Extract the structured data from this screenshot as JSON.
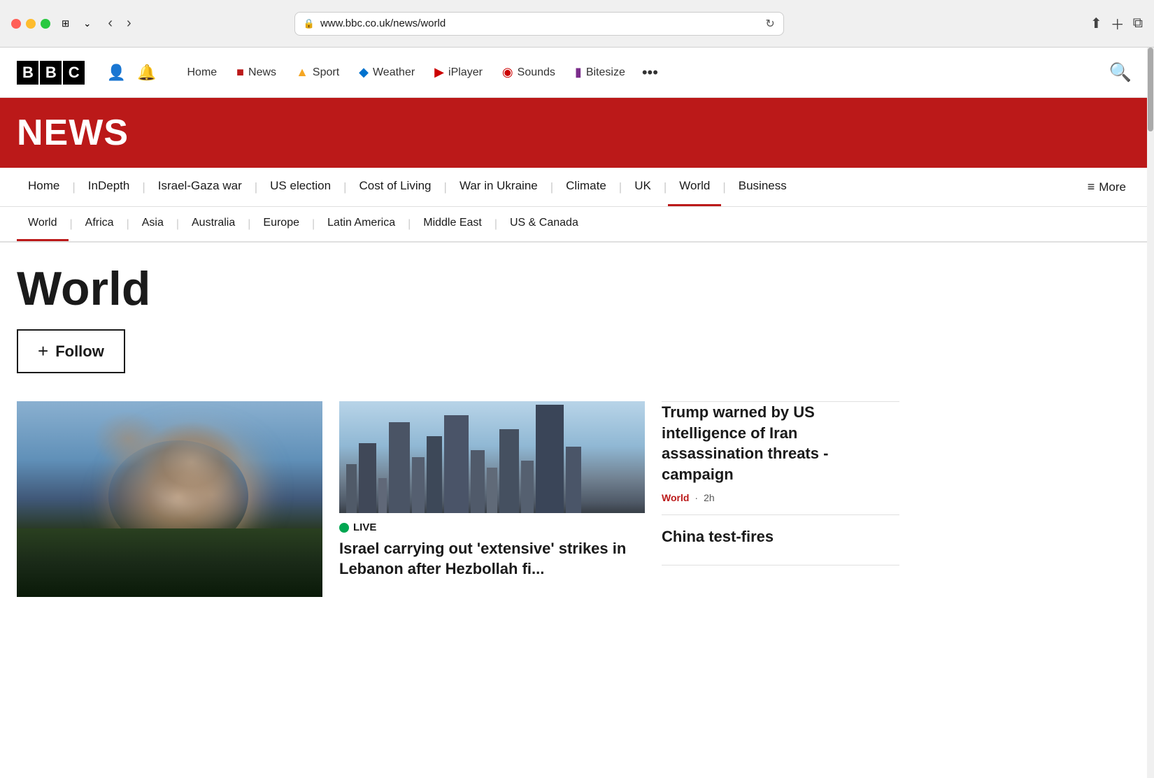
{
  "browser": {
    "url": "www.bbc.co.uk/news/world",
    "lock_icon": "🔒"
  },
  "bbc_header": {
    "logo_letters": [
      "B",
      "B",
      "C"
    ],
    "user_icon": "👤",
    "bell_icon": "🔔",
    "nav_items": [
      {
        "label": "Home",
        "icon": "",
        "icon_color": ""
      },
      {
        "label": "News",
        "icon": "■",
        "icon_color": "#bb1919"
      },
      {
        "label": "Sport",
        "icon": "▲",
        "icon_color": "#f5a623"
      },
      {
        "label": "Weather",
        "icon": "◆",
        "icon_color": "#0072ce"
      },
      {
        "label": "iPlayer",
        "icon": "▶",
        "icon_color": "#cc0000"
      },
      {
        "label": "Sounds",
        "icon": "◉",
        "icon_color": "#cc0000"
      },
      {
        "label": "Bitesize",
        "icon": "▮",
        "icon_color": "#7b2d8b"
      }
    ],
    "more_label": "•••",
    "search_icon": "🔍"
  },
  "news_banner": {
    "title": "NEWS"
  },
  "sub_nav": {
    "items": [
      {
        "label": "Home",
        "active": false
      },
      {
        "label": "InDepth",
        "active": false
      },
      {
        "label": "Israel-Gaza war",
        "active": false
      },
      {
        "label": "US election",
        "active": false
      },
      {
        "label": "Cost of Living",
        "active": false
      },
      {
        "label": "War in Ukraine",
        "active": false
      },
      {
        "label": "Climate",
        "active": false
      },
      {
        "label": "UK",
        "active": false
      },
      {
        "label": "World",
        "active": true
      },
      {
        "label": "Business",
        "active": false
      }
    ],
    "more_label": "More"
  },
  "world_nav": {
    "items": [
      {
        "label": "World",
        "active": true
      },
      {
        "label": "Africa",
        "active": false
      },
      {
        "label": "Asia",
        "active": false
      },
      {
        "label": "Australia",
        "active": false
      },
      {
        "label": "Europe",
        "active": false
      },
      {
        "label": "Latin America",
        "active": false
      },
      {
        "label": "Middle East",
        "active": false
      },
      {
        "label": "US & Canada",
        "active": false
      }
    ]
  },
  "page": {
    "title": "World",
    "follow_button": "Follow",
    "follow_plus": "+"
  },
  "articles": {
    "main": {
      "alt": "Explosion smoke cloud over landscape"
    },
    "secondary": {
      "live_label": "LIVE",
      "headline": "Israel carrying out 'extensive' strikes in Lebanon after Hezbollah fi...",
      "alt": "Tel Aviv city skyline"
    },
    "right": [
      {
        "headline": "Trump warned by US intelligence of Iran assassination threats - campaign",
        "tag": "World",
        "time": "2h"
      },
      {
        "headline": "China test-fires",
        "tag": "",
        "time": ""
      }
    ]
  },
  "colors": {
    "bbc_red": "#bb1919",
    "live_green": "#00a651",
    "text_dark": "#1a1a1a",
    "text_muted": "#555"
  }
}
